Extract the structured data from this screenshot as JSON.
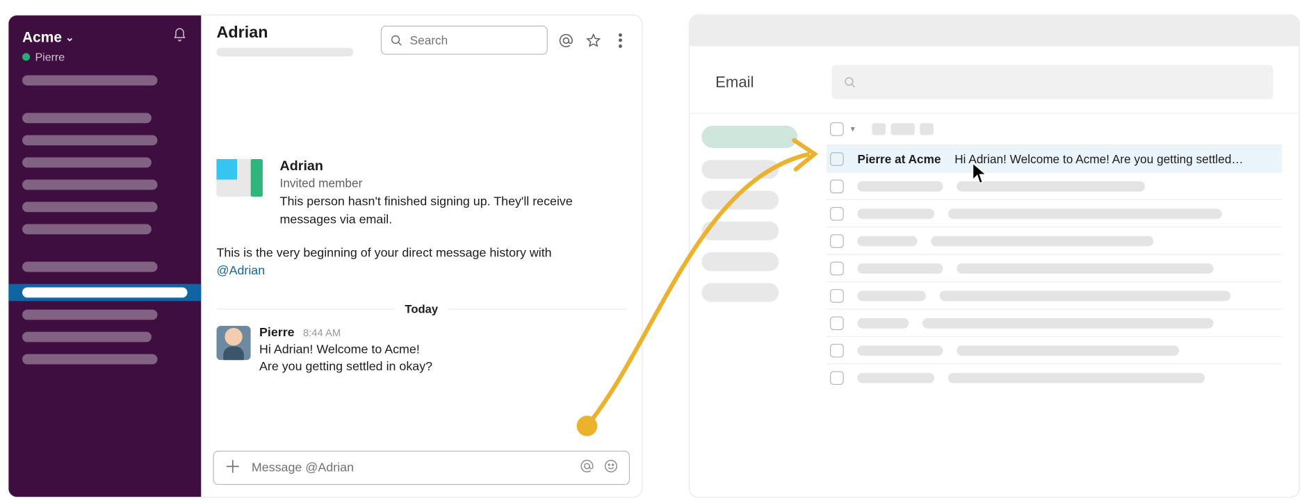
{
  "slack": {
    "workspace_name": "Acme",
    "current_user": "Pierre",
    "channel": {
      "title": "Adrian",
      "search_placeholder": "Search"
    },
    "intro": {
      "name": "Adrian",
      "subtitle": "Invited member",
      "description": "This person hasn't finished signing up. They'll receive messages via email.",
      "beginning_prefix": "This is the very beginning of your direct message history with ",
      "mention": "@Adrian"
    },
    "divider": "Today",
    "message": {
      "author": "Pierre",
      "time": "8:44 AM",
      "line1": "Hi Adrian! Welcome to Acme!",
      "line2": "Are you getting settled in okay?"
    },
    "composer_placeholder": "Message @Adrian"
  },
  "email": {
    "title": "Email",
    "row": {
      "sender": "Pierre at Acme",
      "subject": "Hi Adrian! Welcome to Acme! Are you getting settled…"
    }
  }
}
